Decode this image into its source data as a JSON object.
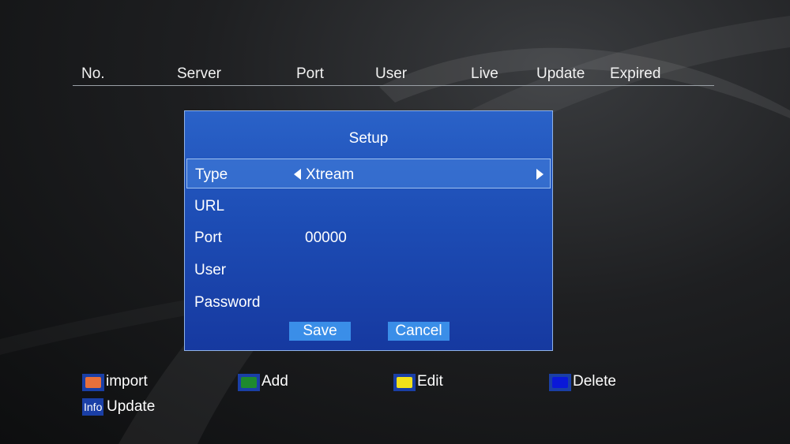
{
  "table": {
    "columns": [
      "No.",
      "Server",
      "Port",
      "User",
      "Live",
      "Update",
      "Expired"
    ]
  },
  "dialog": {
    "title": "Setup",
    "fields": [
      {
        "label": "Type",
        "value": "Xtream"
      },
      {
        "label": "URL",
        "value": ""
      },
      {
        "label": "Port",
        "value": "00000"
      },
      {
        "label": "User",
        "value": ""
      },
      {
        "label": "Password",
        "value": ""
      }
    ],
    "save_label": "Save",
    "cancel_label": "Cancel"
  },
  "legend": {
    "import": {
      "label": "import",
      "color": "#e8703a"
    },
    "add": {
      "label": "Add",
      "color": "#1e8a2e"
    },
    "edit": {
      "label": "Edit",
      "color": "#f2e11a"
    },
    "delete": {
      "label": "Delete",
      "color": "#0a18d8"
    },
    "info": {
      "badge": "Info",
      "label": "Update"
    }
  },
  "colors": {
    "dialog_bg": "#1d4db5",
    "button_bg": "#3a8ee8",
    "selected_row": "#4682dc"
  }
}
